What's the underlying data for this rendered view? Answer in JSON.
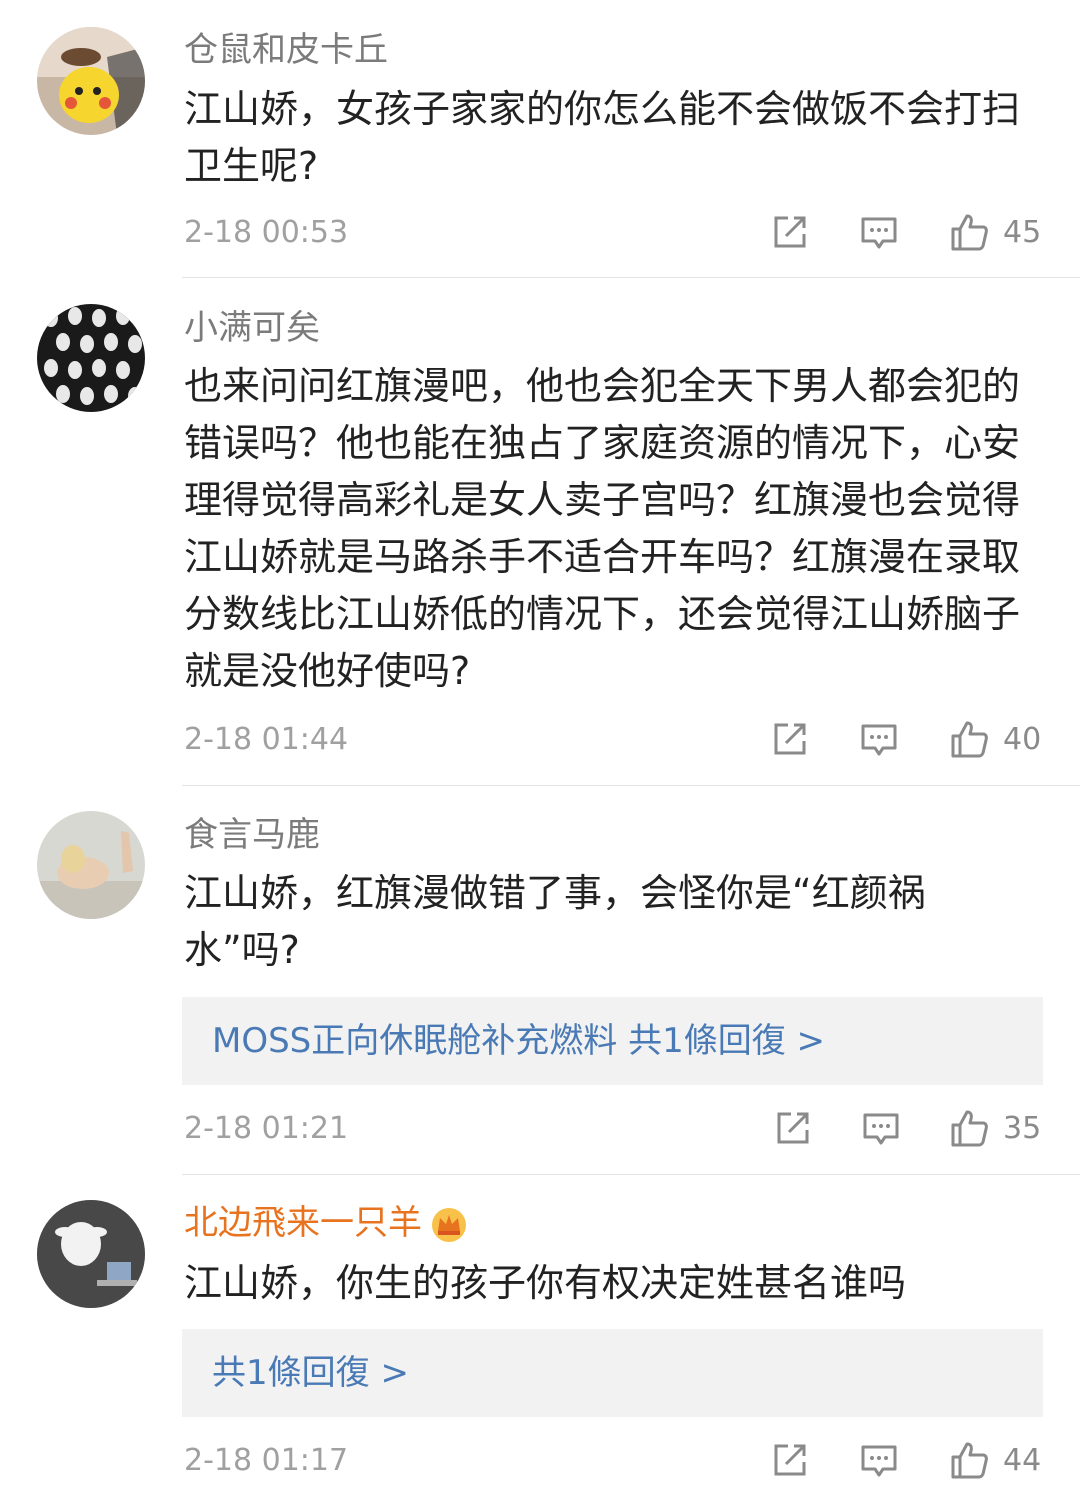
{
  "comments": [
    {
      "username": "仓鼠和皮卡丘",
      "lines": [
        "江山娇，女孩子家家的你怎么能不会做饭不会打扫",
        "卫生呢?"
      ],
      "timestamp": "2-18 00:53",
      "likes": "45"
    },
    {
      "username": "小满可矣",
      "lines": [
        "也来问问红旗漫吧，他也会犯全天下男人都会犯的",
        "错误吗？他也能在独占了家庭资源的情况下，心安",
        "理得觉得高彩礼是女人卖子宫吗？红旗漫也会觉得",
        "江山娇就是马路杀手不适合开车吗？红旗漫在录取",
        "分数线比江山娇低的情况下，还会觉得江山娇脑子",
        "就是没他好使吗?"
      ],
      "timestamp": "2-18 01:44",
      "likes": "40"
    },
    {
      "username": "食言马鹿",
      "lines": [
        "江山娇，红旗漫做错了事，会怪你是“红颜祸",
        "水”吗?"
      ],
      "reply": "MOSS正向休眠舱补充燃料  共1條回復 >",
      "timestamp": "2-18 01:21",
      "likes": "35"
    },
    {
      "username": "北边飛来一只羊",
      "lines": [
        "江山娇，你生的孩子你有权决定姓甚名谁吗"
      ],
      "reply": "共1條回復 >",
      "timestamp": "2-18 01:17",
      "likes": "44",
      "badge_icon": "crown-badge-icon"
    }
  ],
  "icons": {
    "share": "share-icon",
    "comment": "comment-icon",
    "like": "thumbs-up-icon"
  },
  "colors": {
    "username": "#7b7b7b",
    "vip_username": "#e8731f",
    "reply_link": "#4a7ab5",
    "timestamp": "#a0a0a0",
    "reply_bg": "#f2f2f2"
  }
}
